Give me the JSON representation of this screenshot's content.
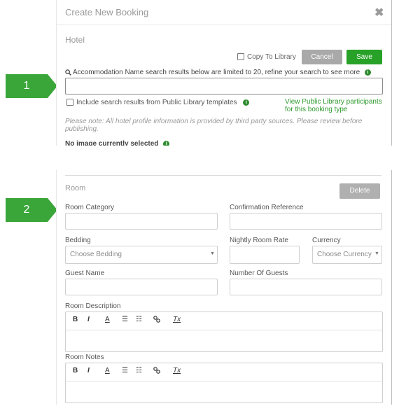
{
  "callouts": [
    "1",
    "2"
  ],
  "modal": {
    "title": "Create New Booking",
    "close_symbol": "✖",
    "section": "Hotel",
    "copy_to_library": "Copy To Library",
    "cancel": "Cancel",
    "save": "Save",
    "search_note": "Accommodation Name search results below are limited to 20, refine your search to see more",
    "search_value": "",
    "include_label": "Include search results from Public Library templates",
    "view_link_line1": "View Public Library participants",
    "view_link_line2": "for this booking type",
    "note": "Please note: All hotel profile information is provided by third party sources. Please review before publishing.",
    "no_image": "No image currently selected"
  },
  "room": {
    "section": "Room",
    "delete": "Delete",
    "room_category_label": "Room Category",
    "room_category_value": "",
    "confirmation_label": "Confirmation Reference",
    "confirmation_value": "",
    "bedding_label": "Bedding",
    "bedding_placeholder": "Choose Bedding",
    "nightly_rate_label": "Nightly Room Rate",
    "nightly_rate_value": "",
    "currency_label": "Currency",
    "currency_placeholder": "Choose Currency",
    "guest_name_label": "Guest Name",
    "guest_name_value": "",
    "guests_label": "Number Of Guests",
    "guests_value": "",
    "description_label": "Room Description",
    "notes_label": "Room Notes"
  },
  "toolbar": {
    "bold": "B",
    "italic": "I",
    "color": "A",
    "ordered_list": "☰",
    "bullet_list": "☷",
    "link": "🔗",
    "clear": "Tx"
  },
  "colors": {
    "accent_green": "#27a127",
    "callout_green": "#3aa63a",
    "link_green": "#2e9a2e",
    "button_gray": "#a9a9a9"
  },
  "icons": {
    "search": "magnifier-icon",
    "info": "info-icon",
    "caret": "chevron-down-icon"
  }
}
